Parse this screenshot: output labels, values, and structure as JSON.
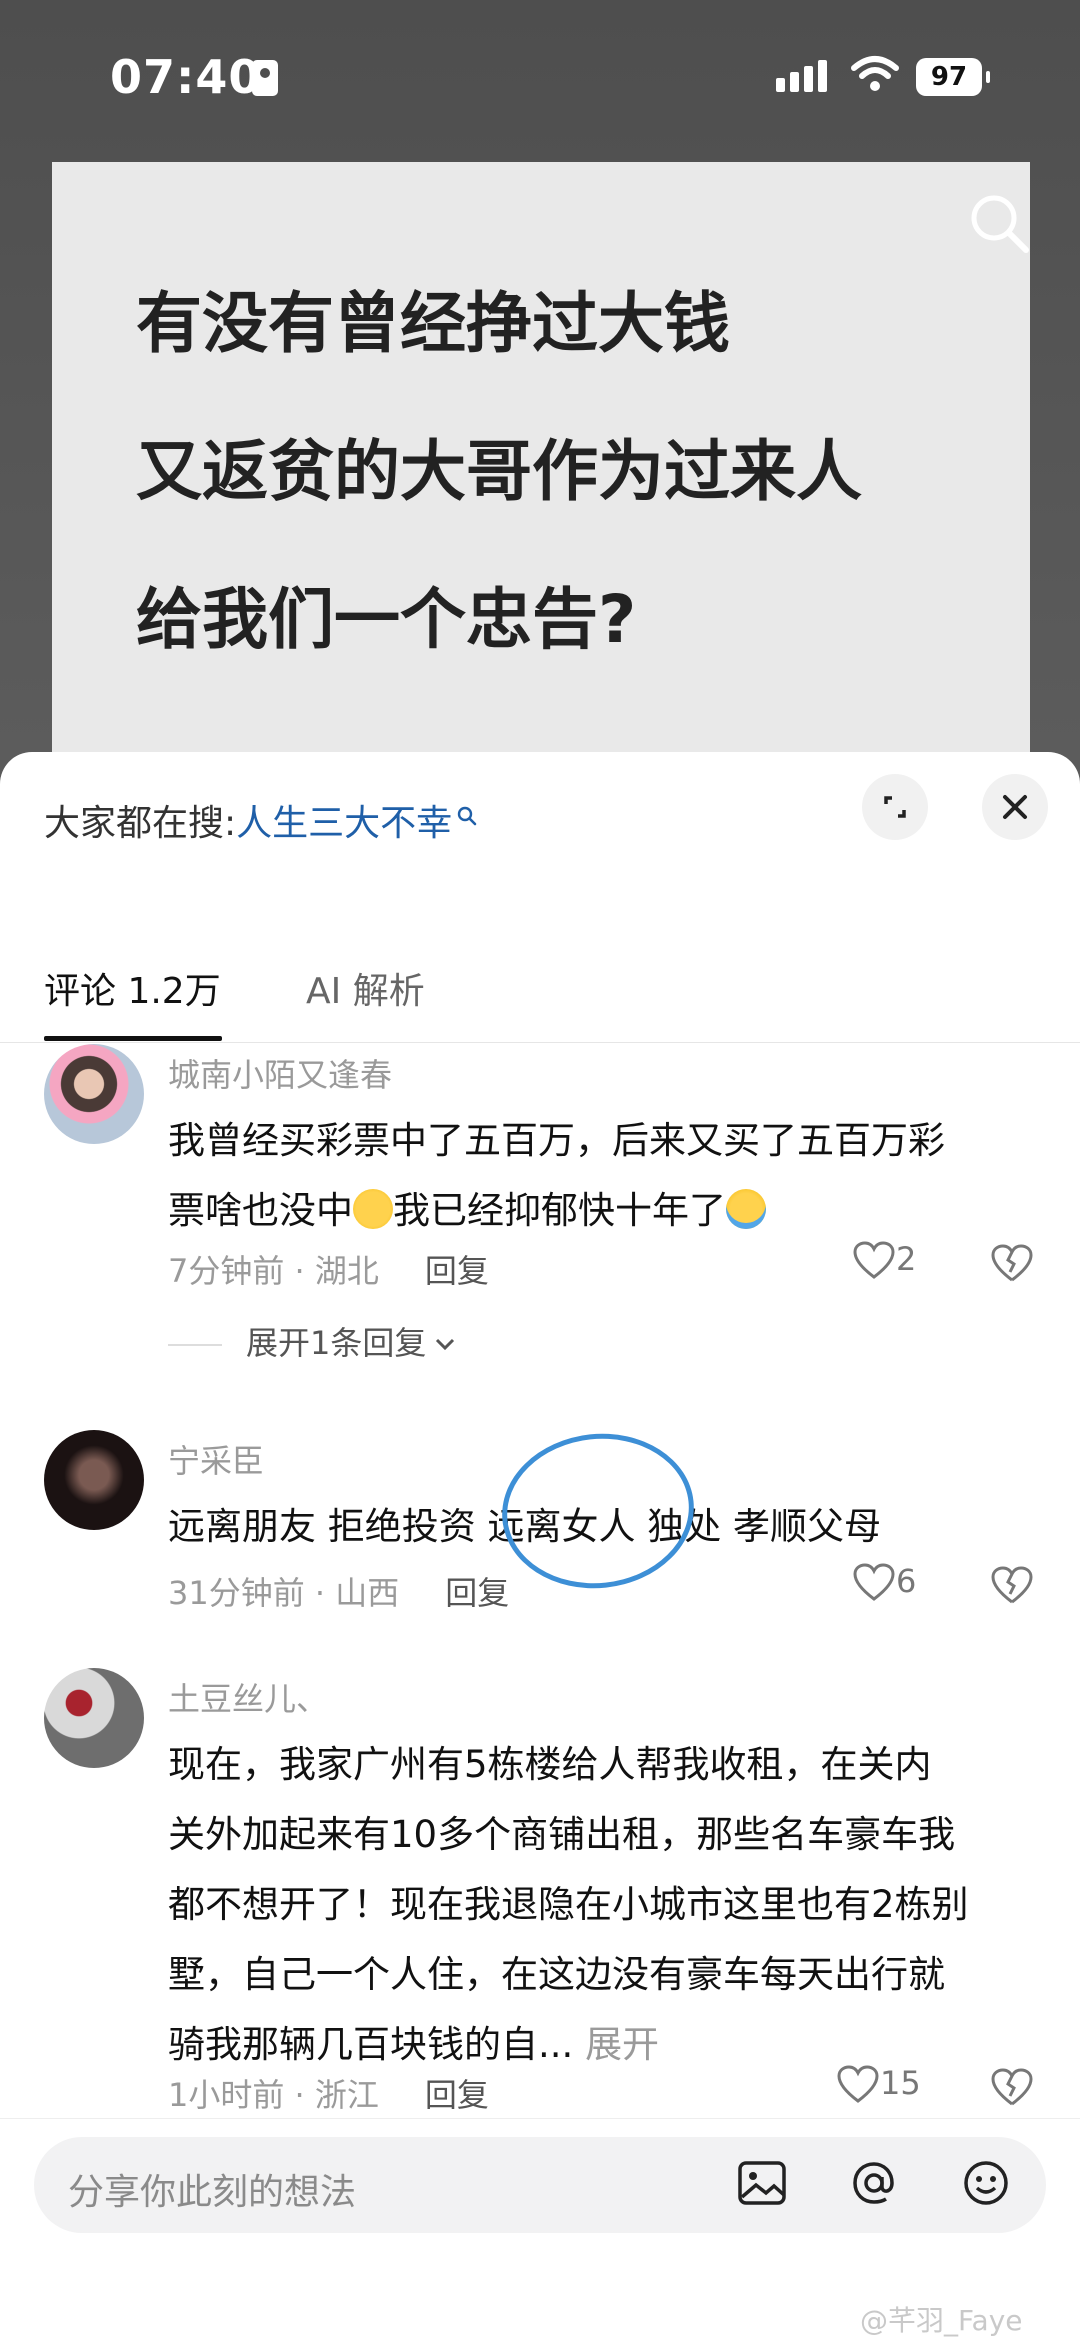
{
  "status_bar": {
    "time": "07:40",
    "battery": "97"
  },
  "post": {
    "title_lines": [
      "有没有曾经挣过大钱",
      "又返贫的大哥作为过来人",
      "给我们一个忠告?"
    ]
  },
  "sheet": {
    "hot_search_prefix": "大家都在搜:",
    "hot_search_keyword": "人生三大不幸",
    "tabs": [
      {
        "label": "评论 1.2万"
      },
      {
        "label": "AI 解析"
      }
    ]
  },
  "comments": [
    {
      "username": "城南小陌又逢春",
      "lines": [
        "我曾经买彩票中了五百万，后来又买了五百万彩",
        "票啥也没中",
        "我已经抑郁快十年了"
      ],
      "time_location": "7分钟前 · 湖北",
      "reply_label": "回复",
      "likes": "2",
      "expand_label": "展开1条回复"
    },
    {
      "username": "宁采臣",
      "text": "远离朋友 拒绝投资 远离女人 独处 孝顺父母",
      "time_location": "31分钟前 · 山西",
      "reply_label": "回复",
      "likes": "6"
    },
    {
      "username": "土豆丝儿、",
      "lines": [
        "现在，我家广州有5栋楼给人帮我收租，在关内",
        "关外加起来有10多个商铺出租，那些名车豪车我",
        "都不想开了！现在我退隐在小城市这里也有2栋别",
        "墅，自己一个人住，在这边没有豪车每天出行就",
        "骑我那辆几百块钱的自..."
      ],
      "more_label": "展开",
      "time_location": "1小时前 · 浙江",
      "reply_label": "回复",
      "likes": "15"
    }
  ],
  "composer": {
    "placeholder": "分享你此刻的想法"
  },
  "watermark": "@芊羽_Faye",
  "colors": {
    "accent_link": "#1f5fa8",
    "annotation_circle": "#3d8fd6"
  },
  "icons": [
    "search-icon",
    "expand-icon",
    "close-icon",
    "heart-icon",
    "broken-heart-icon",
    "image-icon",
    "at-icon",
    "emoji-icon",
    "wifi-icon",
    "signal-icon",
    "chevron-down-icon"
  ]
}
